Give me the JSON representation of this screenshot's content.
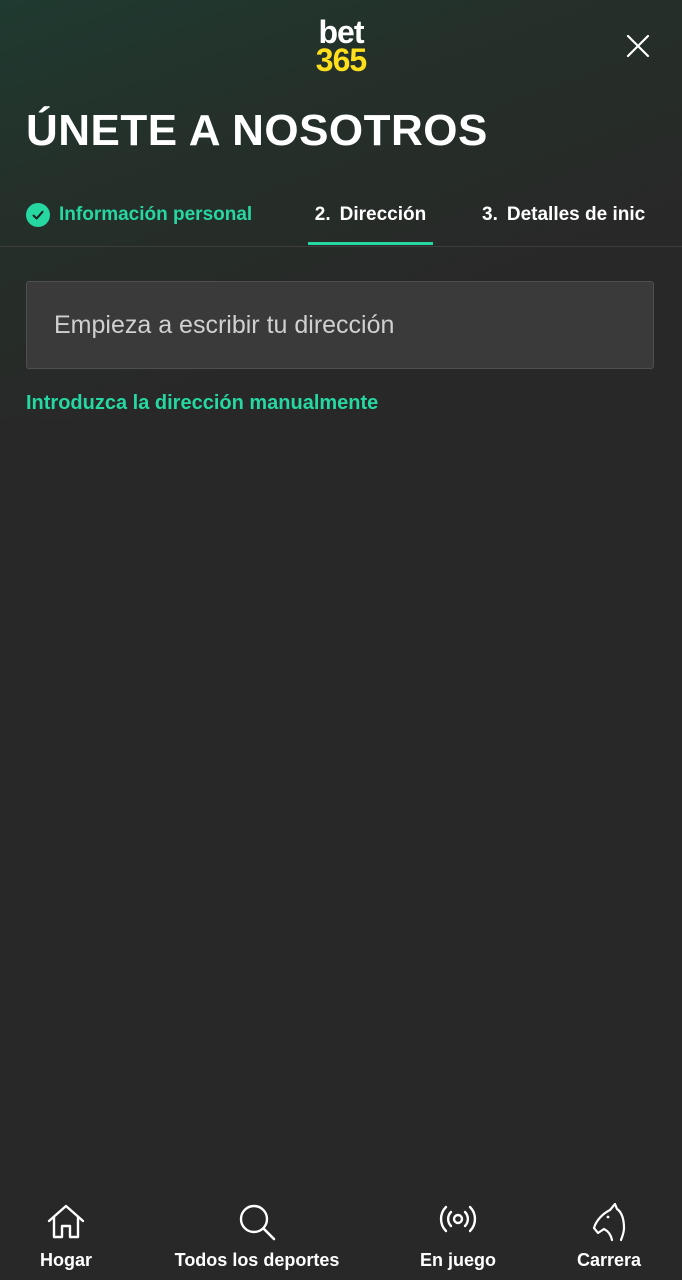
{
  "header": {
    "logo_top": "bet",
    "logo_bottom": "365",
    "title": "ÚNETE A NOSOTROS",
    "close_icon": "close-icon"
  },
  "steps": [
    {
      "number": "",
      "label": "Información personal",
      "status": "completed",
      "icon": "check-circle-icon"
    },
    {
      "number": "2.",
      "label": "Dirección",
      "status": "active"
    },
    {
      "number": "3.",
      "label": "Detalles de inic",
      "status": "upcoming"
    }
  ],
  "address": {
    "placeholder": "Empieza a escribir tu dirección",
    "value": "",
    "manual_link": "Introduzca la dirección manualmente"
  },
  "bottom_nav": [
    {
      "label": "Hogar",
      "icon": "home-icon"
    },
    {
      "label": "Todos los deportes",
      "icon": "search-icon"
    },
    {
      "label": "En juego",
      "icon": "live-broadcast-icon"
    },
    {
      "label": "Carrera",
      "icon": "horse-head-icon"
    }
  ],
  "colors": {
    "accent": "#26d7a2",
    "logo_yellow": "#ffdf1b",
    "background": "#282828",
    "input_background": "#3a3a3a"
  }
}
